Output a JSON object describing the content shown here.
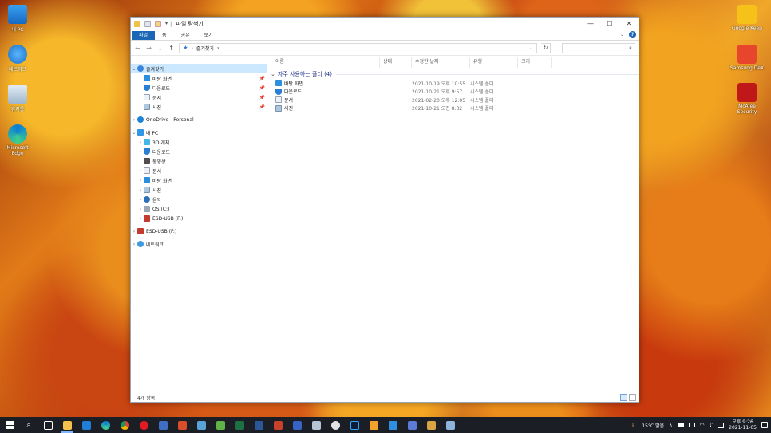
{
  "window": {
    "title": "파일 탐색기",
    "controls": {
      "minimize": "—",
      "maximize": "☐",
      "close": "✕"
    }
  },
  "ribbon": {
    "tabs": [
      "파일",
      "홈",
      "공유",
      "보기"
    ],
    "expand_icon": "⌄",
    "help_icon": "?"
  },
  "address": {
    "back": "←",
    "forward": "→",
    "recent": "⌄",
    "up": "↑",
    "path_root_icon": "★",
    "separator1": "›",
    "path": "즐겨찾기",
    "separator2": "›",
    "dropdown": "⌄",
    "refresh": "↻",
    "search_placeholder": "",
    "search_icon": "⌕"
  },
  "nav": {
    "quick_access": "즐겨찾기",
    "quick_items": [
      "바탕 화면",
      "다운로드",
      "문서",
      "사진"
    ],
    "onedrive": "OneDrive - Personal",
    "this_pc": "내 PC",
    "pc_items": [
      "3D 개체",
      "다운로드",
      "동영상",
      "문서",
      "바탕 화면",
      "사진",
      "음악",
      "OS (C:)",
      "ESD-USB (F:)"
    ],
    "usb": "ESD-USB (F:)",
    "network": "네트워크"
  },
  "columns": [
    "이름",
    "상태",
    "수정한 날짜",
    "유형",
    "크기"
  ],
  "group": {
    "title": "자주 사용하는 폴더 (4)",
    "items": [
      {
        "name": "바탕 화면",
        "date": "2021-10-19 오후 10:55",
        "type": "시스템 폴더"
      },
      {
        "name": "다운로드",
        "date": "2021-10-21 오후 9:57",
        "type": "시스템 폴더"
      },
      {
        "name": "문서",
        "date": "2021-02-20 오후 12:05",
        "type": "시스템 폴더"
      },
      {
        "name": "사진",
        "date": "2021-10-21 오전 8:32",
        "type": "시스템 폴더"
      }
    ]
  },
  "status": {
    "count": "4개 항목"
  },
  "desktop": {
    "left_icons": [
      "내 PC",
      "네트워크",
      "휴지통",
      "Microsoft Edge"
    ],
    "right_icons": [
      "Google Keep",
      "Samsung DeX",
      "McAfee Security"
    ]
  },
  "taskbar": {
    "weather": "15°C 맑음",
    "time": "오후 9:26",
    "date": "2021-11-05",
    "tray_expand": "∧"
  }
}
